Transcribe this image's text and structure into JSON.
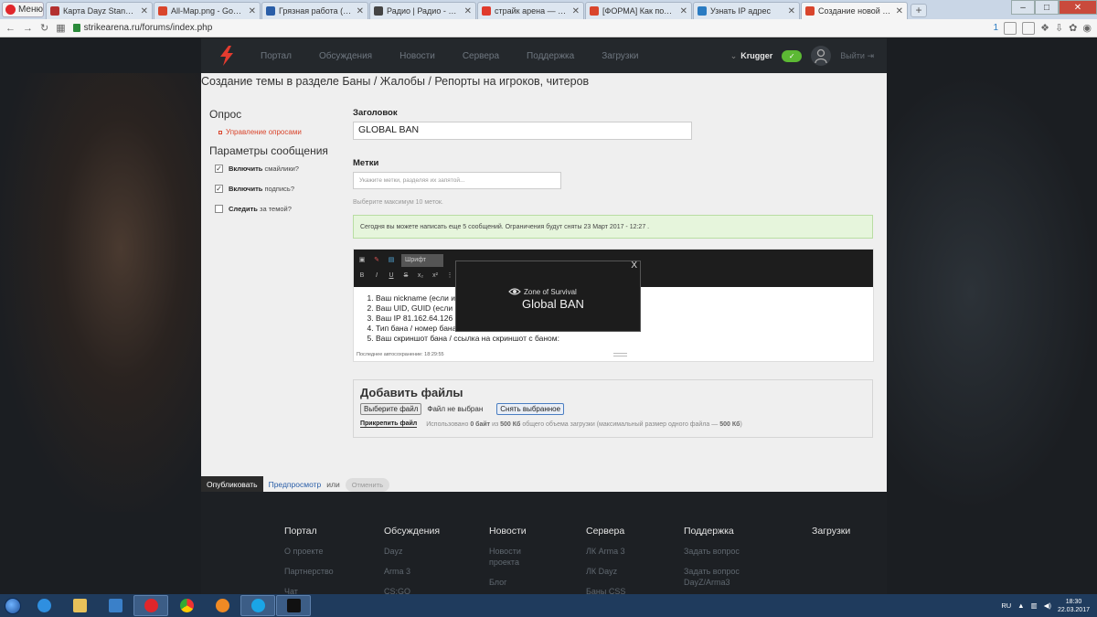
{
  "browser": {
    "menu_label": "Меню",
    "tabs": [
      {
        "title": "Карта Dayz Standalone",
        "color": "#b33030"
      },
      {
        "title": "All-Map.png - Google Ди",
        "color": "#d9452c"
      },
      {
        "title": "Грязная работа (Сериал",
        "color": "#2a5ea8"
      },
      {
        "title": "Радио | Радио - RECORD",
        "color": "#444444"
      },
      {
        "title": "страйк арена — Яндекс:",
        "color": "#e03a2c"
      },
      {
        "title": "[ФОРМА] Как получить р",
        "color": "#d9452c"
      },
      {
        "title": "Узнать IP адрес",
        "color": "#2a7bc2"
      },
      {
        "title": "Создание новой темы - ",
        "color": "#d9452c",
        "active": true
      }
    ],
    "new_tab": "+",
    "address": "strikearena.ru/forums/index.php",
    "addr_badge": "1"
  },
  "site": {
    "nav": [
      "Портал",
      "Обсуждения",
      "Новости",
      "Сервера",
      "Поддержка",
      "Загрузки"
    ],
    "username": "Krugger",
    "logout": "Выйти",
    "brand_color": "#e33b2f"
  },
  "page": {
    "title": "Создание темы в разделе Баны / Жалобы / Репорты на игроков, читеров"
  },
  "sidebar": {
    "poll_heading": "Опрос",
    "poll_link": "Управление опросами",
    "params_heading": "Параметры сообщения",
    "options": [
      {
        "bold": "Включить",
        "rest": " смайлики?",
        "checked": "✓"
      },
      {
        "bold": "Включить",
        "rest": " подпись?",
        "checked": "✓"
      },
      {
        "bold": "Следить",
        "rest": " за темой?",
        "checked": ""
      }
    ]
  },
  "form": {
    "title_label": "Заголовок",
    "title_value": "GLOBAL BAN",
    "tags_label": "Метки",
    "tags_placeholder": "Укажите метки, разделяя их запятой...",
    "tags_hint": "Выберите максимум 10 меток.",
    "notice": "Сегодня вы можете написать еще 5 сообщений. Ограничения будут сняты 23 Март 2017 - 12:27 ."
  },
  "editor": {
    "font_label": "Шрифт",
    "lines": [
      "Ваш nickname (если и",
      "Ваш UID, GUID (если",
      "Ваш IP  81.162.64.126",
      "Тип бана / номер бана  Global Ban",
      "Ваш скриншот бана / ссылка на скриншот с баном:"
    ],
    "autosave": "Последнее автосохранение: 18:29:55"
  },
  "popup": {
    "close": "X",
    "brand": "Zone of Survival",
    "title": "Global BAN"
  },
  "files": {
    "heading": "Добавить файлы",
    "choose_button": "Выберите файл",
    "no_file": "Файл не выбран",
    "remove_button": "Снять выбранное",
    "attach_button": "Прикрепить файл",
    "usage_pre": "Использовано ",
    "usage_used": "0 байт",
    "usage_mid": " из ",
    "usage_total": "500 Кб",
    "usage_post": " общего объема загрузки (максимальный размер одного файла — ",
    "usage_max": "500 Кб",
    "usage_end": ")"
  },
  "actions": {
    "publish": "Опубликовать",
    "preview": "Предпросмотр",
    "or": "или",
    "cancel": "Отменить"
  },
  "footer": {
    "columns": [
      {
        "title": "Портал",
        "links": [
          "О проекте",
          "Партнерство",
          "Чат"
        ]
      },
      {
        "title": "Обсуждения",
        "links": [
          "Dayz",
          "Arma 3",
          "CS:GO"
        ]
      },
      {
        "title": "Новости",
        "links": [
          "Новости проекта",
          "Блог"
        ]
      },
      {
        "title": "Сервера",
        "links": [
          "ЛК Arma 3",
          "ЛК Dayz",
          "Баны CSS"
        ]
      },
      {
        "title": "Поддержка",
        "links": [
          "Задать вопрос",
          "Задать вопрос DayZ/Arma3"
        ]
      },
      {
        "title": "Загрузки",
        "links": []
      }
    ]
  },
  "taskbar": {
    "lang": "RU",
    "time": "18:30",
    "date": "22.03.2017"
  }
}
